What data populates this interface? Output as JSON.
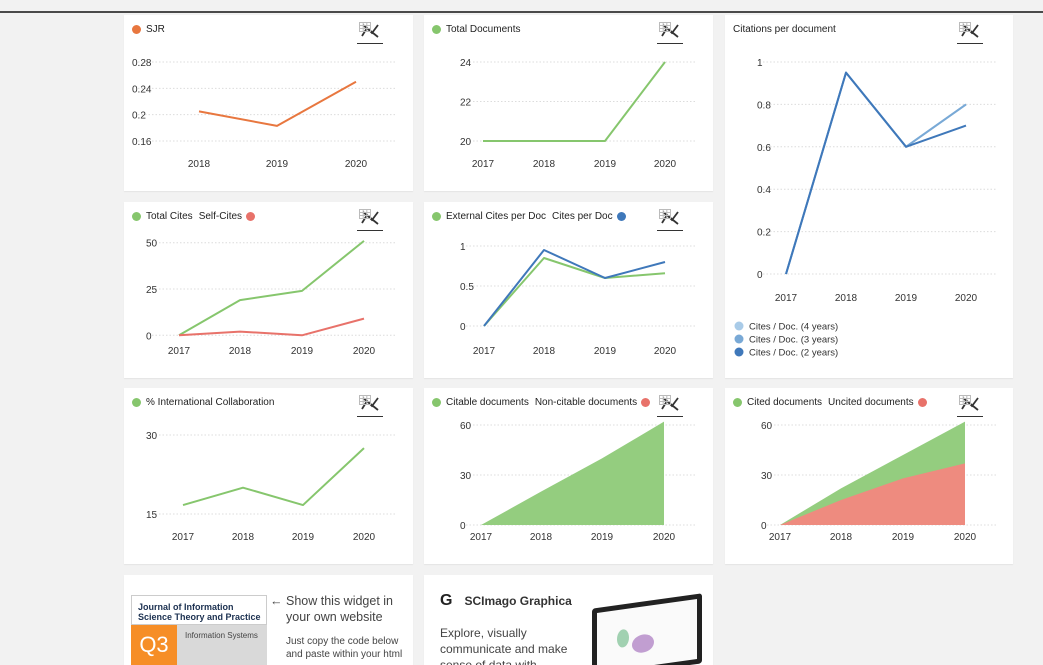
{
  "colors": {
    "orange": "#e8773f",
    "green": "#86c66d",
    "red": "#e8726a",
    "blue": "#3f78ba",
    "blue_mid": "#79a9d6",
    "blue_light": "#a9cbe8",
    "area_green": "#94cd7f",
    "area_red": "#ee8b7f"
  },
  "icons": {
    "line": "line-chart-icon",
    "table": "table-grid-icon"
  },
  "charts": [
    {
      "id": "sjr",
      "legend": [
        {
          "label": "SJR",
          "color": "#e8773f",
          "side": "left"
        }
      ],
      "chart_data": {
        "type": "line",
        "x": [
          2018,
          2019,
          2020
        ],
        "series": [
          {
            "name": "SJR",
            "values": [
              0.205,
              0.183,
              0.25
            ],
            "color": "#e8773f"
          }
        ],
        "ylim": [
          0.16,
          0.28
        ],
        "yticks": [
          "0.28",
          "0.24",
          "0.2",
          "0.16"
        ],
        "ytick_values": [
          0.28,
          0.24,
          0.2,
          0.16
        ],
        "xticks": [
          "2018",
          "2019",
          "2020"
        ],
        "grid": true
      }
    },
    {
      "id": "total-documents",
      "legend": [
        {
          "label": "Total Documents",
          "color": "#86c66d",
          "side": "left"
        }
      ],
      "chart_data": {
        "type": "line",
        "x": [
          2017,
          2018,
          2019,
          2020
        ],
        "series": [
          {
            "name": "Total Documents",
            "values": [
              20,
              20,
              20,
              24
            ],
            "color": "#86c66d"
          }
        ],
        "ylim": [
          20,
          24
        ],
        "yticks": [
          "24",
          "22",
          "20"
        ],
        "ytick_values": [
          24,
          22,
          20
        ],
        "xticks": [
          "2017",
          "2018",
          "2019",
          "2020"
        ],
        "grid": true
      }
    },
    {
      "id": "citations-per-document",
      "title": "Citations per document",
      "chart_data": {
        "type": "line",
        "x": [
          2017,
          2018,
          2019,
          2020
        ],
        "series": [
          {
            "name": "Cites / Doc. (4 years)",
            "values": [
              0,
              0.95,
              0.6,
              0.8
            ],
            "color": "#a9cbe8"
          },
          {
            "name": "Cites / Doc. (3 years)",
            "values": [
              0,
              0.95,
              0.6,
              0.8
            ],
            "color": "#79a9d6"
          },
          {
            "name": "Cites / Doc. (2 years)",
            "values": [
              0,
              0.95,
              0.6,
              0.7
            ],
            "color": "#3f78ba"
          }
        ],
        "ylim": [
          0,
          1
        ],
        "yticks": [
          "1",
          "0.8",
          "0.6",
          "0.4",
          "0.2",
          "0"
        ],
        "ytick_values": [
          1,
          0.8,
          0.6,
          0.4,
          0.2,
          0
        ],
        "xticks": [
          "2017",
          "2018",
          "2019",
          "2020"
        ],
        "legend_position": "bottom-left",
        "grid": true
      }
    },
    {
      "id": "total-cites",
      "legend": [
        {
          "label": "Total Cites",
          "color": "#86c66d",
          "side": "left"
        },
        {
          "label": "Self-Cites",
          "color": "#e8726a",
          "side": "right"
        }
      ],
      "chart_data": {
        "type": "line",
        "x": [
          2017,
          2018,
          2019,
          2020
        ],
        "series": [
          {
            "name": "Total Cites",
            "values": [
              0,
              19,
              24,
              51
            ],
            "color": "#86c66d"
          },
          {
            "name": "Self-Cites",
            "values": [
              0,
              2,
              0,
              9
            ],
            "color": "#e8726a"
          }
        ],
        "ylim": [
          -2,
          52
        ],
        "yticks": [
          "50",
          "25",
          "0"
        ],
        "ytick_values": [
          50,
          25,
          0
        ],
        "xticks": [
          "2017",
          "2018",
          "2019",
          "2020"
        ],
        "grid": true
      }
    },
    {
      "id": "external-cites",
      "legend": [
        {
          "label": "External Cites per Doc",
          "color": "#86c66d",
          "side": "left"
        },
        {
          "label": "Cites per Doc",
          "color": "#3f78ba",
          "side": "right"
        }
      ],
      "chart_data": {
        "type": "line",
        "x": [
          2017,
          2018,
          2019,
          2020
        ],
        "series": [
          {
            "name": "External Cites per Doc",
            "values": [
              0,
              0.85,
              0.6,
              0.66
            ],
            "color": "#86c66d"
          },
          {
            "name": "Cites per Doc",
            "values": [
              0,
              0.95,
              0.6,
              0.8
            ],
            "color": "#3f78ba"
          }
        ],
        "ylim": [
          0,
          1
        ],
        "yticks": [
          "1",
          "0.5",
          "0"
        ],
        "ytick_values": [
          1,
          0.5,
          0
        ],
        "xticks": [
          "2017",
          "2018",
          "2019",
          "2020"
        ],
        "grid": true
      }
    },
    {
      "id": "international-collaboration",
      "legend": [
        {
          "label": "% International Collaboration",
          "color": "#86c66d",
          "side": "left"
        }
      ],
      "chart_data": {
        "type": "line",
        "x": [
          2017,
          2018,
          2019,
          2020
        ],
        "series": [
          {
            "name": "% International Collaboration",
            "values": [
              16.7,
              20,
              16.7,
              27.5
            ],
            "color": "#86c66d"
          }
        ],
        "ylim": [
          15,
          30
        ],
        "yticks": [
          "30",
          "15"
        ],
        "ytick_values": [
          30,
          15
        ],
        "xticks": [
          "2017",
          "2018",
          "2019",
          "2020"
        ],
        "grid": true
      }
    },
    {
      "id": "citable-documents",
      "legend": [
        {
          "label": "Citable documents",
          "color": "#86c66d",
          "side": "left"
        },
        {
          "label": "Non-citable documents",
          "color": "#e8726a",
          "side": "right"
        }
      ],
      "chart_data": {
        "type": "area",
        "x": [
          2017,
          2018,
          2019,
          2020
        ],
        "series": [
          {
            "name": "Citable documents",
            "values": [
              0,
              20,
              40,
              62
            ],
            "color": "#94cd7f"
          },
          {
            "name": "Non-citable documents",
            "values": [
              0,
              0,
              0,
              0
            ],
            "color": "#ee8b7f"
          }
        ],
        "ylim": [
          0,
          60
        ],
        "yticks": [
          "60",
          "30",
          "0"
        ],
        "ytick_values": [
          60,
          30,
          0
        ],
        "xticks": [
          "2017",
          "2018",
          "2019",
          "2020"
        ],
        "grid": true
      }
    },
    {
      "id": "cited-documents",
      "legend": [
        {
          "label": "Cited documents",
          "color": "#86c66d",
          "side": "left"
        },
        {
          "label": "Uncited documents",
          "color": "#e8726a",
          "side": "right"
        }
      ],
      "chart_data": {
        "type": "area",
        "x": [
          2017,
          2018,
          2019,
          2020
        ],
        "series": [
          {
            "name": "Cited documents",
            "values": [
              0,
              22,
              42,
              62
            ],
            "color": "#94cd7f"
          },
          {
            "name": "Uncited documents",
            "values": [
              0,
              15,
              28,
              37
            ],
            "color": "#ee8b7f"
          }
        ],
        "stacked_display": "overlap",
        "ylim": [
          0,
          60
        ],
        "yticks": [
          "60",
          "30",
          "0"
        ],
        "ytick_values": [
          60,
          30,
          0
        ],
        "xticks": [
          "2017",
          "2018",
          "2019",
          "2020"
        ],
        "grid": true
      }
    }
  ],
  "widget": {
    "journal_title": "Journal of Information Science Theory and Practice",
    "quartile": "Q3",
    "category": "Information Systems",
    "share_title": "Show this widget in your own website",
    "share_arrow": "←",
    "share_text": "Just copy the code below and paste within your html"
  },
  "graphica": {
    "logo": "G",
    "title": "SCImago Graphica",
    "text": "Explore, visually communicate and make sense of data with"
  }
}
